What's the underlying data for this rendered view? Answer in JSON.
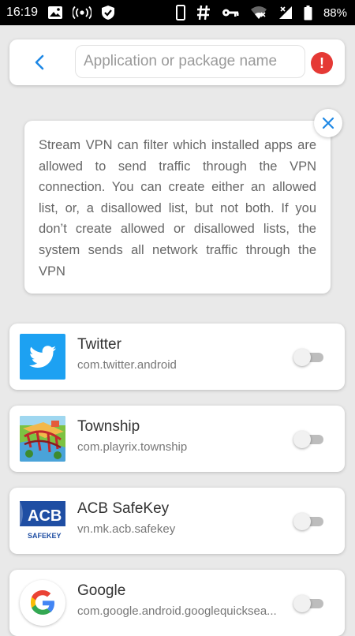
{
  "status_bar": {
    "time": "16:19",
    "battery": "88%",
    "left_icons": [
      "image-icon",
      "broadcast-icon",
      "shield-check-icon"
    ],
    "right_icons": [
      "phone-icon",
      "hash-icon",
      "key-icon",
      "wifi-icon",
      "signal-icon",
      "battery-icon"
    ]
  },
  "search": {
    "placeholder": "Application or package name",
    "value": ""
  },
  "colors": {
    "accent": "#1e88e5",
    "alert": "#e53935",
    "background": "#e9e9e9",
    "twitter_blue": "#1da1f2",
    "acb_blue": "#1f4ea3"
  },
  "info": {
    "text": "Stream VPN can filter which installed apps are allowed to send traffic through the VPN connection. You can create either an allowed list, or, a disallowed list, but not both. If you don’t create allowed or disallowed lists, the system sends all network traffic through the VPN"
  },
  "apps": [
    {
      "name": "Twitter",
      "package": "com.twitter.android",
      "icon": "twitter-icon",
      "enabled": false
    },
    {
      "name": "Township",
      "package": "com.playrix.township",
      "icon": "township-icon",
      "enabled": false
    },
    {
      "name": "ACB SafeKey",
      "package": "vn.mk.acb.safekey",
      "icon": "acb-safekey-icon",
      "enabled": false,
      "icon_text": [
        "ACB",
        "SAFEKEY"
      ]
    },
    {
      "name": "Google",
      "package": "com.google.android.googlequicksea...",
      "icon": "google-icon",
      "enabled": false
    }
  ]
}
